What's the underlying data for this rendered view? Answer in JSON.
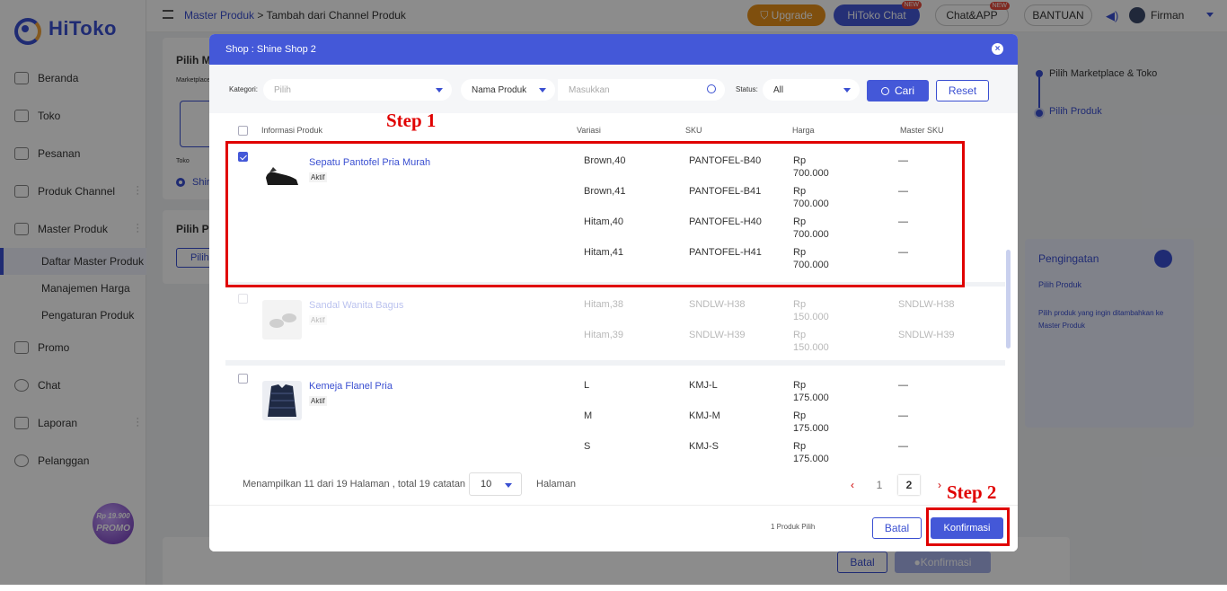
{
  "app": {
    "name": "HiToko"
  },
  "sidebar": {
    "items": [
      {
        "label": "Beranda"
      },
      {
        "label": "Toko"
      },
      {
        "label": "Pesanan"
      },
      {
        "label": "Produk Channel"
      },
      {
        "label": "Master Produk"
      },
      {
        "label": "Daftar Master Produk"
      },
      {
        "label": "Manajemen Harga"
      },
      {
        "label": "Pengaturan Produk"
      },
      {
        "label": "Promo"
      },
      {
        "label": "Chat"
      },
      {
        "label": "Laporan"
      },
      {
        "label": "Pelanggan"
      }
    ],
    "promo": {
      "price": "Rp 19.900",
      "label": "PROMO"
    }
  },
  "header": {
    "breadcrumb_root": "Master Produk",
    "breadcrumb_sep": " > ",
    "breadcrumb_current": "Tambah dari Channel Produk",
    "upgrade": "Upgrade",
    "chat": "HiToko Chat",
    "chatapp": "Chat&APP",
    "new_tag": "NEW",
    "help": "BANTUAN",
    "user": "Firman"
  },
  "background": {
    "card1_title": "Pilih M",
    "card1_sub": "Marketplace",
    "toko_label": "Toko",
    "shop_short": "Shir",
    "card2_title": "Pilih P",
    "card2_btn": "Pilih",
    "steps": [
      "Pilih Marketplace & Toko",
      "Pilih Produk"
    ],
    "tip_title": "Pengingatan",
    "tip_sub": "Pilih Produk",
    "tip_text": "Pilih produk yang ingin ditambahkan ke Master Produk",
    "bottom_cancel": "Batal",
    "bottom_confirm": "Konfirmasi"
  },
  "modal": {
    "title": "Shop :  Shine Shop 2",
    "filter": {
      "kategori_label": "Kategori:",
      "kategori_placeholder": "Pilih",
      "field_select": "Nama Produk",
      "search_placeholder": "Masukkan",
      "status_label": "Status:",
      "status_value": "All",
      "search_btn": "Cari",
      "reset_btn": "Reset"
    },
    "columns": [
      "Informasi Produk",
      "Variasi",
      "SKU",
      "Harga",
      "Master SKU"
    ],
    "products": [
      {
        "name": "Sepatu Pantofel Pria Murah",
        "status": "Aktif",
        "checked": true,
        "variants": [
          {
            "var": "Brown,40",
            "sku": "PANTOFEL-B40",
            "cur": "Rp",
            "price": "700.000",
            "msku": "—"
          },
          {
            "var": "Brown,41",
            "sku": "PANTOFEL-B41",
            "cur": "Rp",
            "price": "700.000",
            "msku": "—"
          },
          {
            "var": "Hitam,40",
            "sku": "PANTOFEL-H40",
            "cur": "Rp",
            "price": "700.000",
            "msku": "—"
          },
          {
            "var": "Hitam,41",
            "sku": "PANTOFEL-H41",
            "cur": "Rp",
            "price": "700.000",
            "msku": "—"
          }
        ]
      },
      {
        "name": "Sandal Wanita Bagus",
        "status": "Aktif",
        "checked": false,
        "variants": [
          {
            "var": "Hitam,38",
            "sku": "SNDLW-H38",
            "cur": "Rp",
            "price": "150.000",
            "msku": "SNDLW-H38"
          },
          {
            "var": "Hitam,39",
            "sku": "SNDLW-H39",
            "cur": "Rp",
            "price": "150.000",
            "msku": "SNDLW-H39"
          }
        ]
      },
      {
        "name": "Kemeja Flanel Pria",
        "status": "Aktif",
        "checked": false,
        "variants": [
          {
            "var": "L",
            "sku": "KMJ-L",
            "cur": "Rp",
            "price": "175.000",
            "msku": "—"
          },
          {
            "var": "M",
            "sku": "KMJ-M",
            "cur": "Rp",
            "price": "175.000",
            "msku": "—"
          },
          {
            "var": "S",
            "sku": "KMJ-S",
            "cur": "Rp",
            "price": "175.000",
            "msku": "—"
          }
        ]
      }
    ],
    "pagination": {
      "summary": "Menampilkan 11 dari 19 Halaman , total 19 catatan",
      "page_size": "10",
      "page_label": "Halaman",
      "prev": "‹",
      "pages": [
        "1",
        "2"
      ],
      "next": "›"
    },
    "footer": {
      "selected": "1 Produk Pilih",
      "cancel": "Batal",
      "confirm": "Konfirmasi"
    }
  },
  "annotations": {
    "step1": "Step 1",
    "step2": "Step 2"
  }
}
